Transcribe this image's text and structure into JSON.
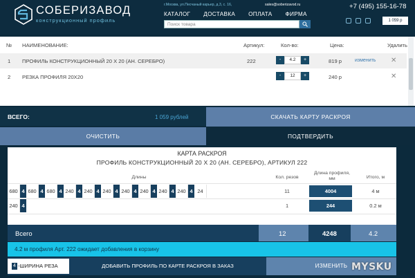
{
  "header": {
    "logo_title": "СОБЕРИЗАВОД",
    "logo_subtitle": "конструкционный профиль",
    "address": "г.Москва, ул.Песчаный карьер, д.3, с. 16,",
    "email": "sales@soberizavod.ru",
    "nav": [
      "КАТАЛОГ",
      "ДОСТАВКА",
      "ОПЛАТА",
      "ФИРМА"
    ],
    "search_placeholder": "Поиск товара",
    "phone": "+7 (495) 155-16-78",
    "cart_total": "1 059 р"
  },
  "cart": {
    "columns": {
      "num": "№",
      "name": "НАИМЕНОВАНИЕ:",
      "sku": "Артикул:",
      "qty": "Кол-во:",
      "price": "Цена:",
      "remove": "Удалить"
    },
    "items": [
      {
        "num": "1",
        "name": "ПРОФИЛЬ КОНСТРУКЦИОННЫЙ 20 Х 20 (АН. СЕРЕБРО)",
        "sku": "222",
        "qty": "4.2",
        "price": "819 р",
        "action": "изменить"
      },
      {
        "num": "2",
        "name": "РЕЗКА ПРОФИЛЯ 20Х20",
        "sku": "",
        "qty": "12",
        "price": "240 р",
        "action": ""
      }
    ],
    "total_label": "ВСЕГО:",
    "total_value": "1 059 рублей",
    "download_map": "СКАЧАТЬ КАРТУ РАСКРОЯ",
    "clear": "ОЧИСТИТЬ",
    "confirm": "ПОДТВЕРДИТЬ"
  },
  "cutting_map": {
    "title": "КАРТА РАСКРОЯ",
    "subtitle": "ПРОФИЛЬ КОНСТРУКЦИОННЫЙ 20 Х 20 (АН. СЕРЕБРО), АРТИКУЛ 222",
    "headers": {
      "lengths": "Длины",
      "cuts": "Кол. резов",
      "profile_length": "Длина профиля, мм",
      "total": "Итого, м"
    },
    "rows": [
      {
        "segments": [
          "680",
          "4",
          "680",
          "4",
          "680",
          "4",
          "240",
          "4",
          "240",
          "4",
          "240",
          "4",
          "240",
          "4",
          "240",
          "4",
          "240",
          "4",
          "240",
          "4",
          "24"
        ],
        "cuts": "11",
        "length": "4004",
        "total": "4 м"
      },
      {
        "segments": [
          "240",
          "4"
        ],
        "cuts": "1",
        "length": "244",
        "total": "0.2 м"
      }
    ],
    "grand_total": {
      "label": "Всего",
      "cuts": "12",
      "length": "4248",
      "total": "4.2"
    },
    "notice": "4.2 м профиля Арт. 222 ожидает добавления в корзину",
    "kerf_value": "4",
    "kerf_label": "-ШИРИНА РЕЗА",
    "add_button": "ДОБАВИТЬ ПРОФИЛЬ ПО КАРТЕ РАСКРОЯ В ЗАКАЗ",
    "change_button": "ИЗМЕНИТЬ"
  },
  "watermark": "MYSKU",
  "colors": {
    "dark": "#0d2c3f",
    "accent": "#5e84ad",
    "cyan": "#18c3e8"
  }
}
